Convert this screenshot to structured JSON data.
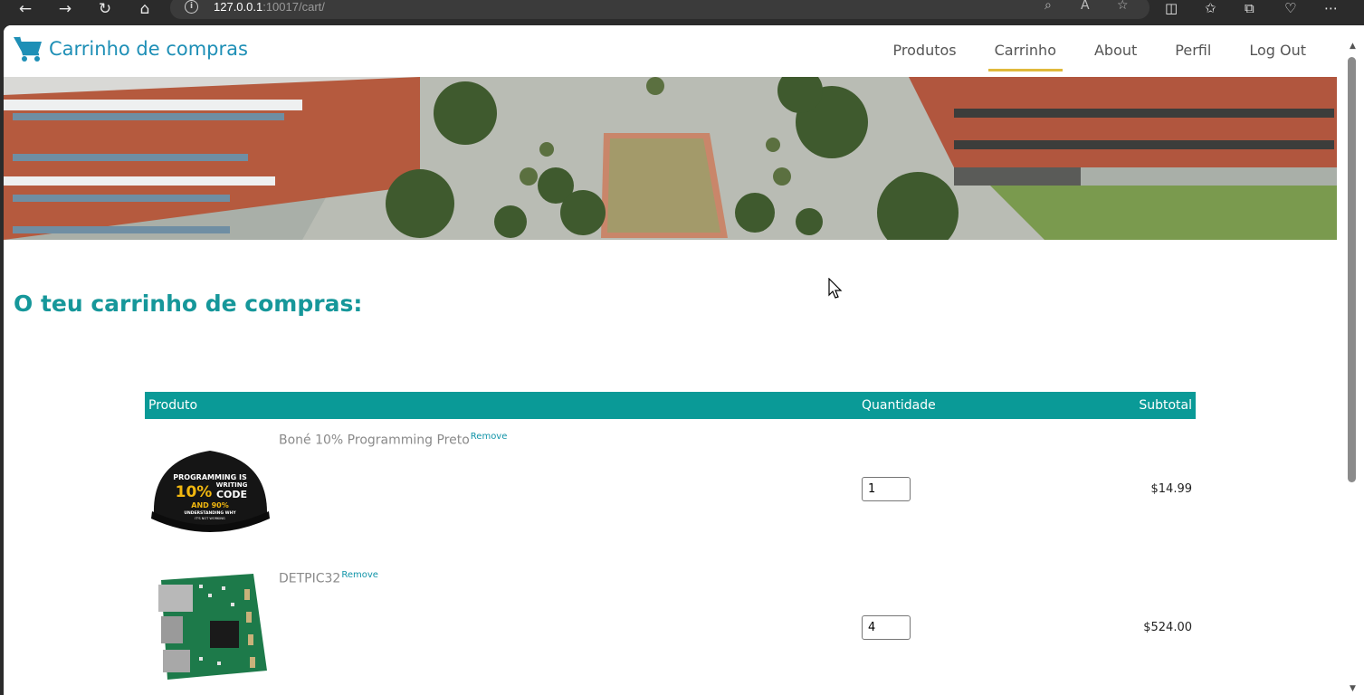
{
  "browser": {
    "url_host": "127.0.0.1",
    "url_rest": ":10017/cart/"
  },
  "navbar": {
    "brand": "Carrinho de compras",
    "links": [
      {
        "label": "Produtos",
        "active": false
      },
      {
        "label": "Carrinho",
        "active": true
      },
      {
        "label": "About",
        "active": false
      },
      {
        "label": "Perfil",
        "active": false
      },
      {
        "label": "Log Out",
        "active": false
      }
    ]
  },
  "page": {
    "heading": "O teu carrinho de compras:"
  },
  "cart": {
    "headers": {
      "product": "Produto",
      "quantity": "Quantidade",
      "subtotal": "Subtotal"
    },
    "remove_label": "Remove",
    "items": [
      {
        "name": "Boné 10% Programming Preto",
        "quantity": "1",
        "subtotal": "$14.99",
        "image": "cap-image"
      },
      {
        "name": "DETPIC32",
        "quantity": "4",
        "subtotal": "$524.00",
        "image": "board-image"
      }
    ]
  },
  "cap_text": {
    "l1": "PROGRAMMING IS",
    "l2": "10%",
    "l3": "WRITING",
    "l4": "CODE",
    "l5": "AND 90%",
    "l6": "UNDERSTANDING WHY",
    "l7": "IT'S NOT WORKING"
  },
  "colors": {
    "accent": "#0a9a97",
    "brand": "#1e8fb6",
    "active_underline": "#e0b93c"
  }
}
